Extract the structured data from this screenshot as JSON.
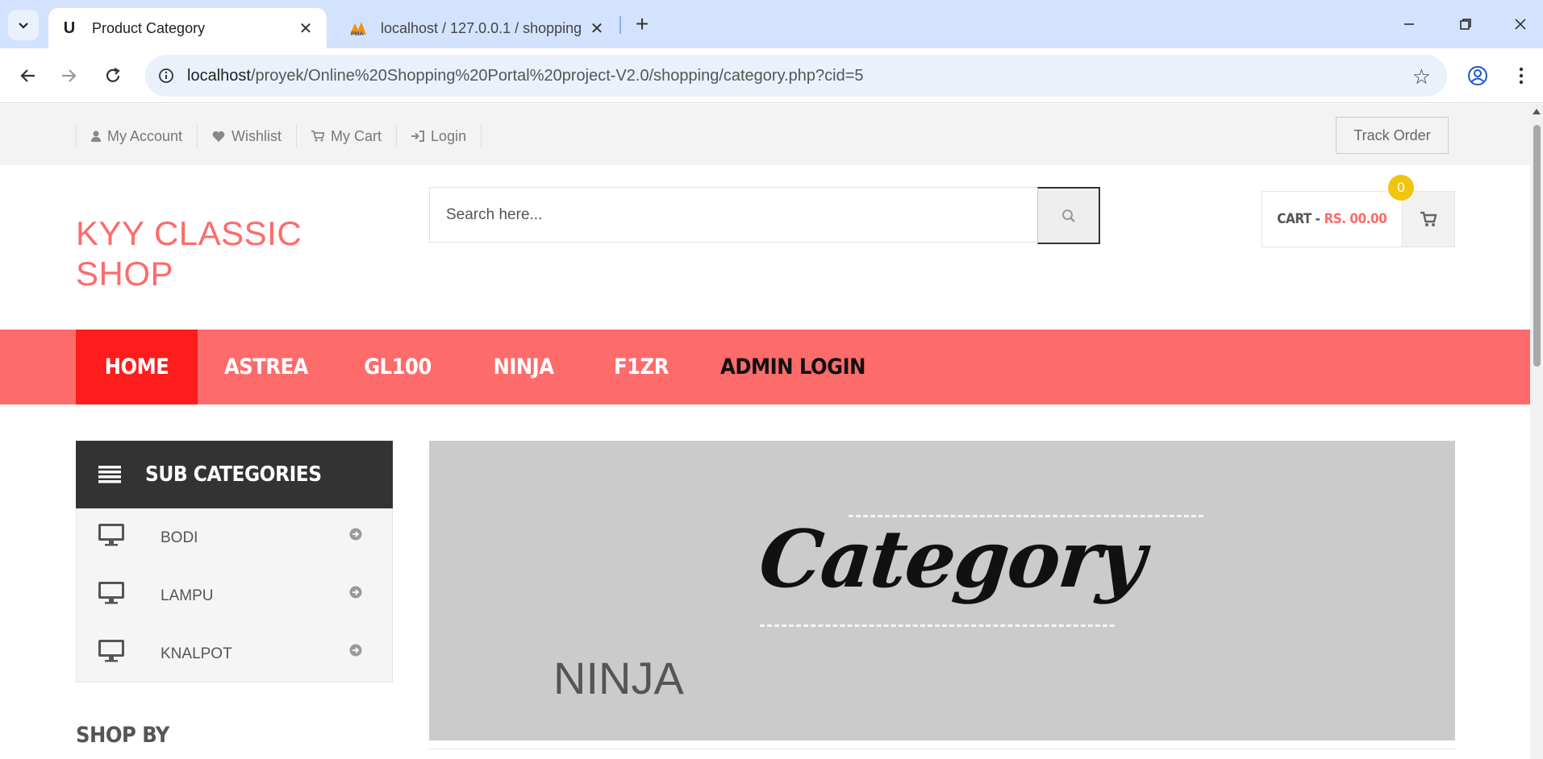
{
  "browser": {
    "tabs": [
      {
        "title": "Product Category",
        "favicon": "U",
        "active": true
      },
      {
        "title": "localhost / 127.0.0.1 / shopping",
        "favicon": "PMA",
        "active": false
      }
    ],
    "url_host": "localhost",
    "url_path": "/proyek/Online%20Shopping%20Portal%20project-V2.0/shopping/category.php?cid=5"
  },
  "topbar": {
    "links": [
      {
        "label": "My Account",
        "icon": "user-icon"
      },
      {
        "label": "Wishlist",
        "icon": "heart-icon"
      },
      {
        "label": "My Cart",
        "icon": "cart-icon"
      },
      {
        "label": "Login",
        "icon": "sign-in-icon"
      }
    ],
    "track_order": "Track Order"
  },
  "header": {
    "logo_line1": "KYY CLASSIC",
    "logo_line2": "SHOP",
    "search_placeholder": "Search here...",
    "cart_label": "CART -",
    "cart_price": "RS. 00.00",
    "cart_count": "0"
  },
  "nav": {
    "items": [
      "HOME",
      "ASTREA",
      "GL100",
      "NINJA",
      "F1ZR",
      "ADMIN LOGIN"
    ]
  },
  "sidebar": {
    "title": "SUB CATEGORIES",
    "items": [
      {
        "label": "BODI"
      },
      {
        "label": "LAMPU"
      },
      {
        "label": "KNALPOT"
      }
    ],
    "shop_by": "SHOP BY"
  },
  "banner": {
    "script_word": "Category",
    "category_name": "NINJA"
  },
  "colors": {
    "brand": "#fe6b6b",
    "nav_active": "#fe1c1c",
    "badge": "#f1c40f",
    "sidebar_head": "#333333"
  }
}
